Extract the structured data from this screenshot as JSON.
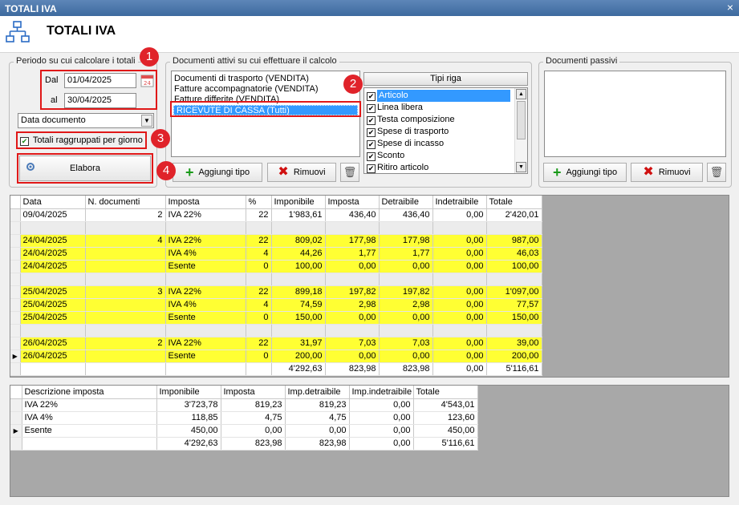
{
  "window": {
    "title": "TOTALI IVA",
    "close_glyph": "×"
  },
  "header": {
    "title": "TOTALI IVA",
    "icon": "network-icon"
  },
  "period": {
    "legend": "Periodo su cui calcolare i totali",
    "dal_label": "Dal",
    "dal_value": "01/04/2025",
    "al_label": "al",
    "al_value": "30/04/2025",
    "calendar_badge": "24",
    "date_type": "Data documento",
    "group_by_day_label": "Totali raggruppati per giorno",
    "group_by_day_checked": true,
    "elabora_label": "Elabora"
  },
  "docs_active": {
    "legend": "Documenti attivi su cui effettuare il calcolo",
    "items": [
      "Documenti di trasporto (VENDITA)",
      "Fatture accompagnatorie (VENDITA)",
      "Fatture differite (VENDITA)",
      "RICEVUTE DI CASSA (Tutti)"
    ],
    "selected_index": 3,
    "add_label": "Aggiungi tipo",
    "remove_label": "Rimuovi"
  },
  "row_types": {
    "header": "Tipi riga",
    "items": [
      {
        "label": "Articolo",
        "checked": true
      },
      {
        "label": "Linea libera",
        "checked": true
      },
      {
        "label": "Testa composizione",
        "checked": true
      },
      {
        "label": "Spese di trasporto",
        "checked": true
      },
      {
        "label": "Spese di incasso",
        "checked": true
      },
      {
        "label": "Sconto",
        "checked": true
      },
      {
        "label": "Ritiro articolo",
        "checked": true
      }
    ],
    "selected_index": 0
  },
  "docs_passive": {
    "legend": "Documenti passivi",
    "add_label": "Aggiungi tipo",
    "remove_label": "Rimuovi"
  },
  "badges": [
    "1",
    "2",
    "3",
    "4"
  ],
  "main_grid": {
    "columns": [
      "Data",
      "N. documenti",
      "Imposta",
      "%",
      "Imponibile",
      "Imposta",
      "Detraibile",
      "Indetraibile",
      "Totale"
    ],
    "rows": [
      {
        "hl": false,
        "blank": false,
        "cells": [
          "09/04/2025",
          "2",
          "IVA 22%",
          "22",
          "1'983,61",
          "436,40",
          "436,40",
          "0,00",
          "2'420,01"
        ]
      },
      {
        "hl": false,
        "blank": true,
        "cells": [
          "",
          "",
          "",
          "",
          "",
          "",
          "",
          "",
          ""
        ]
      },
      {
        "hl": true,
        "blank": false,
        "cells": [
          "24/04/2025",
          "4",
          "IVA 22%",
          "22",
          "809,02",
          "177,98",
          "177,98",
          "0,00",
          "987,00"
        ]
      },
      {
        "hl": true,
        "blank": false,
        "cells": [
          "24/04/2025",
          "",
          "IVA 4%",
          "4",
          "44,26",
          "1,77",
          "1,77",
          "0,00",
          "46,03"
        ]
      },
      {
        "hl": true,
        "blank": false,
        "cells": [
          "24/04/2025",
          "",
          "Esente",
          "0",
          "100,00",
          "0,00",
          "0,00",
          "0,00",
          "100,00"
        ]
      },
      {
        "hl": false,
        "blank": true,
        "cells": [
          "",
          "",
          "",
          "",
          "",
          "",
          "",
          "",
          ""
        ]
      },
      {
        "hl": true,
        "blank": false,
        "cells": [
          "25/04/2025",
          "3",
          "IVA 22%",
          "22",
          "899,18",
          "197,82",
          "197,82",
          "0,00",
          "1'097,00"
        ]
      },
      {
        "hl": true,
        "blank": false,
        "cells": [
          "25/04/2025",
          "",
          "IVA 4%",
          "4",
          "74,59",
          "2,98",
          "2,98",
          "0,00",
          "77,57"
        ]
      },
      {
        "hl": true,
        "blank": false,
        "cells": [
          "25/04/2025",
          "",
          "Esente",
          "0",
          "150,00",
          "0,00",
          "0,00",
          "0,00",
          "150,00"
        ]
      },
      {
        "hl": false,
        "blank": true,
        "cells": [
          "",
          "",
          "",
          "",
          "",
          "",
          "",
          "",
          ""
        ]
      },
      {
        "hl": true,
        "blank": false,
        "cells": [
          "26/04/2025",
          "2",
          "IVA 22%",
          "22",
          "31,97",
          "7,03",
          "7,03",
          "0,00",
          "39,00"
        ]
      },
      {
        "hl": true,
        "blank": false,
        "current": true,
        "cells": [
          "26/04/2025",
          "",
          "Esente",
          "0",
          "200,00",
          "0,00",
          "0,00",
          "0,00",
          "200,00"
        ]
      }
    ],
    "totals": [
      "",
      "",
      "",
      "",
      "4'292,63",
      "823,98",
      "823,98",
      "0,00",
      "5'116,61"
    ]
  },
  "summary_grid": {
    "columns": [
      "Descrizione imposta",
      "Imponibile",
      "Imposta",
      "Imp.detraibile",
      "Imp.indetraibile",
      "Totale"
    ],
    "rows": [
      {
        "cells": [
          "IVA 22%",
          "3'723,78",
          "819,23",
          "819,23",
          "0,00",
          "4'543,01"
        ]
      },
      {
        "cells": [
          "IVA 4%",
          "118,85",
          "4,75",
          "4,75",
          "0,00",
          "123,60"
        ]
      },
      {
        "current": true,
        "cells": [
          "Esente",
          "450,00",
          "0,00",
          "0,00",
          "0,00",
          "450,00"
        ]
      }
    ],
    "totals": [
      "",
      "4'292,63",
      "823,98",
      "823,98",
      "0,00",
      "5'116,61"
    ]
  },
  "colors": {
    "highlight": "#ffff33",
    "selection": "#3399ff",
    "badge": "#e0232a",
    "titlebar": "#4a76aa"
  }
}
